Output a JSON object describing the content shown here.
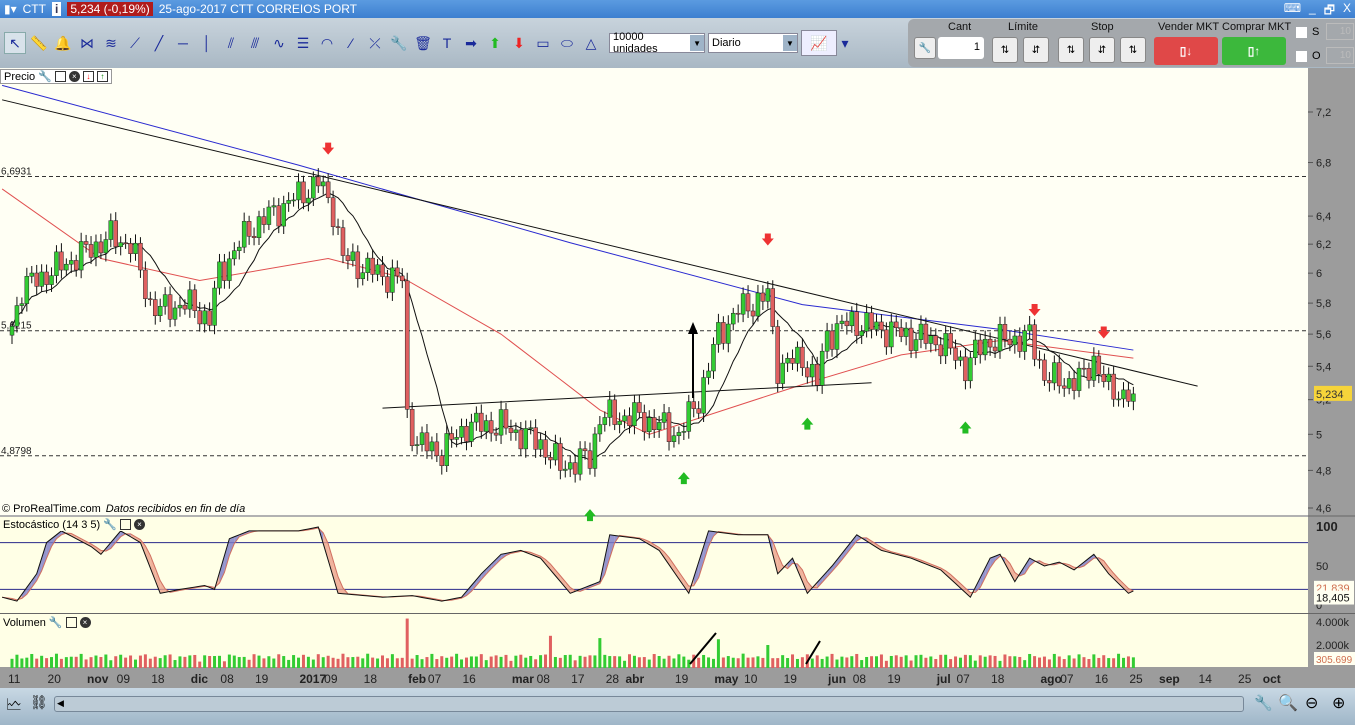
{
  "titlebar": {
    "symbol": "CTT",
    "price_badge": "5,234 (-0,19%)",
    "date_name": "25-ago-2017 CTT CORREIOS PORT",
    "info": "i",
    "controls": [
      "⌨",
      "_",
      "🗗",
      "X"
    ]
  },
  "toolbar": {
    "quantity_select": "10000 unidades",
    "period_select": "Diario",
    "tools": [
      "cursor-icon",
      "ruler-icon",
      "alarm-bell-icon",
      "fan-icon",
      "channel-icon",
      "segment-icon",
      "line-icon",
      "horizontal-line-icon",
      "vertical-line-icon",
      "parallel-icon",
      "fibonacci-icon",
      "wave-icon",
      "retracement-icon",
      "arc-icon",
      "point-icon",
      "cross-icon",
      "wrench-icon",
      "trash-icon",
      "text-icon",
      "arrow-right-icon",
      "arrow-up-icon",
      "arrow-down-icon",
      "rectangle-icon",
      "ellipse-icon",
      "triangle-icon"
    ]
  },
  "trade": {
    "cant_label": "Cant",
    "cant_value": "1",
    "limit_label": "Límite",
    "stop_label": "Stop",
    "sell_label": "Vender MKT",
    "buy_label": "Comprar MKT",
    "s_label": "S",
    "o_label": "O",
    "s_value": "10",
    "o_value": "10"
  },
  "panels": {
    "price": "Precio",
    "stochastic": "Estocástico (14 3 5)",
    "volume": "Volumen",
    "copyright": "© ProRealTime.com",
    "data_note": "Datos recibidos en fin de día"
  },
  "colors": {
    "bg": "#ffffe6",
    "up": "#33cc33",
    "down": "#e06060",
    "ma_blue": "#2a2ad0",
    "ma_red": "#e05050",
    "axis": "#9c9c9c"
  },
  "chart_data": {
    "type": "candlestick",
    "price_axis": {
      "min": 4.6,
      "max": 7.2,
      "scale": "log",
      "ticks": [
        "7,2",
        "6,8",
        "6,4",
        "6,2",
        "6",
        "5,8",
        "5,6",
        "5,4",
        "5,2",
        "5",
        "4,8",
        "4,6"
      ],
      "tick_values": [
        7.2,
        6.8,
        6.4,
        6.2,
        6,
        5.8,
        5.6,
        5.4,
        5.2,
        5,
        4.8,
        4.6
      ]
    },
    "last_price": "5,234",
    "hlines": [
      {
        "value": 6.6931,
        "label": "6,6931"
      },
      {
        "value": 5.6215,
        "label": "5,6215"
      },
      {
        "value": 4.8798,
        "label": "4,8798"
      }
    ],
    "close_keyframes": [
      [
        0,
        5.65
      ],
      [
        2,
        5.9
      ],
      [
        10,
        6.05
      ],
      [
        20,
        6.25
      ],
      [
        24,
        6.2
      ],
      [
        28,
        5.8
      ],
      [
        30,
        5.75
      ],
      [
        35,
        5.8
      ],
      [
        40,
        5.7
      ],
      [
        42,
        6.0
      ],
      [
        48,
        6.3
      ],
      [
        56,
        6.5
      ],
      [
        62,
        6.65
      ],
      [
        65,
        6.45
      ],
      [
        67,
        6.1
      ],
      [
        74,
        6.0
      ],
      [
        79,
        5.95
      ],
      [
        80,
        5.1
      ],
      [
        82,
        4.95
      ],
      [
        87,
        4.9
      ],
      [
        92,
        5.05
      ],
      [
        99,
        5.05
      ],
      [
        107,
        4.95
      ],
      [
        111,
        4.82
      ],
      [
        117,
        4.87
      ],
      [
        119,
        5.1
      ],
      [
        127,
        5.1
      ],
      [
        135,
        5.0
      ],
      [
        139,
        5.2
      ],
      [
        143,
        5.6
      ],
      [
        147,
        5.75
      ],
      [
        153,
        5.85
      ],
      [
        154,
        5.6
      ],
      [
        155,
        5.4
      ],
      [
        160,
        5.45
      ],
      [
        163,
        5.3
      ],
      [
        165,
        5.6
      ],
      [
        170,
        5.68
      ],
      [
        180,
        5.6
      ],
      [
        188,
        5.55
      ],
      [
        193,
        5.4
      ],
      [
        197,
        5.55
      ],
      [
        206,
        5.58
      ],
      [
        209,
        5.35
      ],
      [
        212,
        5.3
      ],
      [
        217,
        5.33
      ],
      [
        219,
        5.45
      ],
      [
        222,
        5.25
      ],
      [
        227,
        5.234
      ]
    ],
    "ma_blue": [
      [
        -2,
        7.42
      ],
      [
        58,
        6.78
      ],
      [
        113,
        6.21
      ],
      [
        160,
        5.79
      ],
      [
        200,
        5.63
      ],
      [
        227,
        5.5
      ]
    ],
    "ma_red": [
      [
        -2,
        6.6
      ],
      [
        18,
        6.1
      ],
      [
        38,
        5.95
      ],
      [
        64,
        6.1
      ],
      [
        79,
        5.97
      ],
      [
        99,
        5.6
      ],
      [
        111,
        5.32
      ],
      [
        119,
        5.14
      ],
      [
        129,
        5.0
      ],
      [
        160,
        5.29
      ],
      [
        180,
        5.47
      ],
      [
        200,
        5.56
      ],
      [
        227,
        5.45
      ]
    ],
    "trendlines": [
      [
        [
          -2,
          7.3
        ],
        [
          240,
          5.28
        ]
      ],
      [
        [
          75,
          5.15
        ],
        [
          174,
          5.3
        ]
      ]
    ],
    "sell_arrows": [
      64,
      153,
      207,
      221
    ],
    "buy_arrows": [
      117,
      136,
      161,
      193
    ],
    "stochastic": {
      "ticks": [
        "100",
        "50",
        "0"
      ],
      "levels": [
        80,
        20
      ],
      "k_value": "18,405",
      "d_value": "21,839",
      "k_keyframes": [
        [
          -2,
          10
        ],
        [
          1,
          5
        ],
        [
          5,
          40
        ],
        [
          7,
          80
        ],
        [
          10,
          95
        ],
        [
          16,
          75
        ],
        [
          18,
          65
        ],
        [
          22,
          95
        ],
        [
          26,
          80
        ],
        [
          30,
          15
        ],
        [
          34,
          20
        ],
        [
          39,
          25
        ],
        [
          41,
          20
        ],
        [
          44,
          85
        ],
        [
          48,
          95
        ],
        [
          58,
          95
        ],
        [
          62,
          100
        ],
        [
          66,
          15
        ],
        [
          75,
          10
        ],
        [
          81,
          12
        ],
        [
          87,
          5
        ],
        [
          91,
          10
        ],
        [
          95,
          40
        ],
        [
          99,
          65
        ],
        [
          103,
          70
        ],
        [
          107,
          60
        ],
        [
          113,
          15
        ],
        [
          119,
          30
        ],
        [
          121,
          90
        ],
        [
          127,
          85
        ],
        [
          131,
          70
        ],
        [
          137,
          15
        ],
        [
          141,
          95
        ],
        [
          147,
          90
        ],
        [
          153,
          90
        ],
        [
          155,
          40
        ],
        [
          158,
          60
        ],
        [
          161,
          15
        ],
        [
          166,
          50
        ],
        [
          171,
          90
        ],
        [
          176,
          70
        ],
        [
          182,
          60
        ],
        [
          188,
          45
        ],
        [
          194,
          10
        ],
        [
          198,
          60
        ],
        [
          200,
          65
        ],
        [
          203,
          30
        ],
        [
          206,
          60
        ],
        [
          209,
          50
        ],
        [
          212,
          55
        ],
        [
          215,
          45
        ],
        [
          219,
          65
        ],
        [
          222,
          40
        ],
        [
          226,
          15
        ],
        [
          227,
          18
        ]
      ]
    },
    "volume": {
      "ticks": [
        "4.000k",
        "2.000k"
      ],
      "tick_values": [
        4000,
        2000
      ],
      "last": "305.699",
      "spikes": [
        [
          80,
          4300
        ],
        [
          109,
          2800
        ],
        [
          119,
          2600
        ],
        [
          143,
          2500
        ],
        [
          153,
          2000
        ]
      ]
    },
    "x_labels": [
      [
        0,
        "11"
      ],
      [
        8,
        "20"
      ],
      [
        16,
        "nov"
      ],
      [
        22,
        "09"
      ],
      [
        29,
        "18"
      ],
      [
        37,
        "dic"
      ],
      [
        43,
        "08"
      ],
      [
        50,
        "19"
      ],
      [
        59,
        "2017"
      ],
      [
        64,
        "09"
      ],
      [
        72,
        "18"
      ],
      [
        81,
        "feb"
      ],
      [
        85,
        "07"
      ],
      [
        92,
        "16"
      ],
      [
        102,
        "mar"
      ],
      [
        107,
        "08"
      ],
      [
        114,
        "17"
      ],
      [
        121,
        "28"
      ],
      [
        125,
        "abr"
      ],
      [
        135,
        "19"
      ],
      [
        143,
        "may"
      ],
      [
        149,
        "10"
      ],
      [
        157,
        "19"
      ],
      [
        166,
        "jun"
      ],
      [
        171,
        "08"
      ],
      [
        178,
        "19"
      ],
      [
        188,
        "jul"
      ],
      [
        192,
        "07"
      ],
      [
        199,
        "18"
      ],
      [
        209,
        "ago"
      ],
      [
        213,
        "07"
      ],
      [
        220,
        "16"
      ],
      [
        227,
        "25"
      ],
      [
        233,
        "sep"
      ],
      [
        241,
        "14"
      ],
      [
        249,
        "25"
      ],
      [
        254,
        "oct"
      ]
    ]
  }
}
